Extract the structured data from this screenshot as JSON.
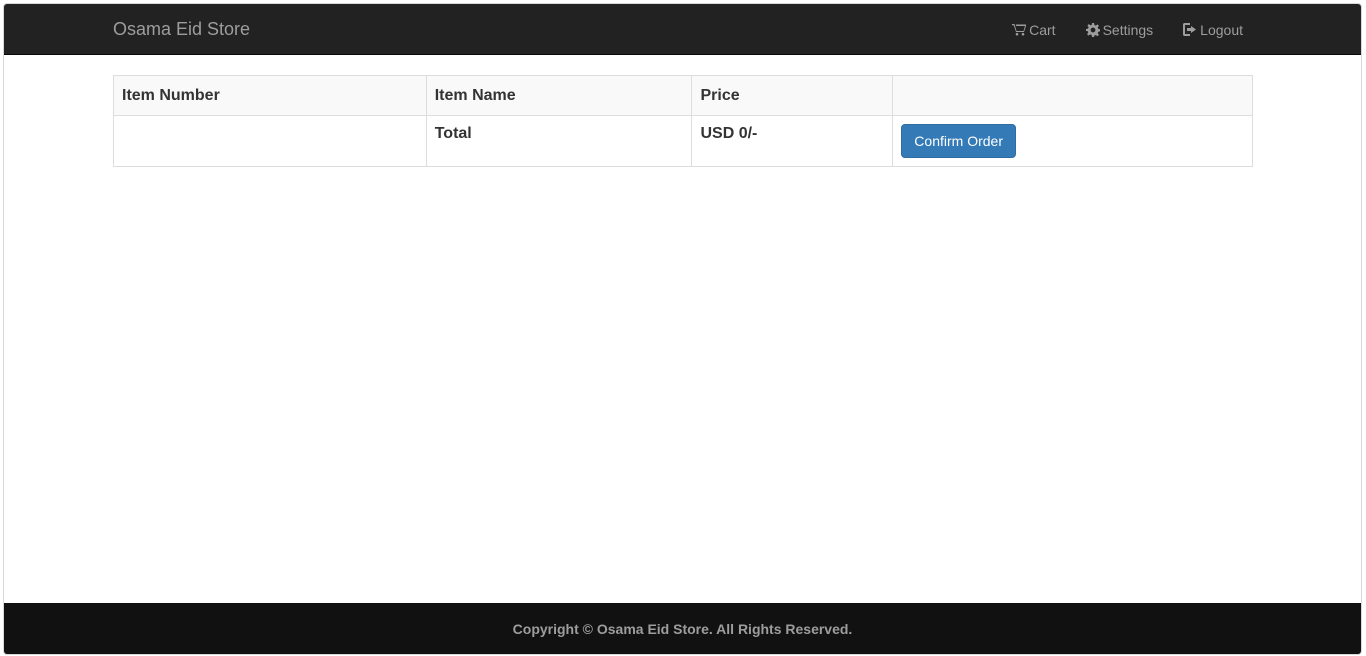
{
  "navbar": {
    "brand": "Osama Eid Store",
    "items": [
      {
        "label": "Cart",
        "icon": "cart-icon"
      },
      {
        "label": "Settings",
        "icon": "gear-icon"
      },
      {
        "label": "Logout",
        "icon": "logout-icon"
      }
    ]
  },
  "table": {
    "headers": [
      "Item Number",
      "Item Name",
      "Price",
      ""
    ],
    "total_row": {
      "item_number": "",
      "label": "Total",
      "price": "USD 0/-",
      "button": "Confirm Order"
    }
  },
  "footer": {
    "text": "Copyright © Osama Eid Store. All Rights Reserved."
  },
  "colors": {
    "navbar_bg": "#222222",
    "footer_bg": "#111111",
    "primary_button": "#337ab7"
  }
}
